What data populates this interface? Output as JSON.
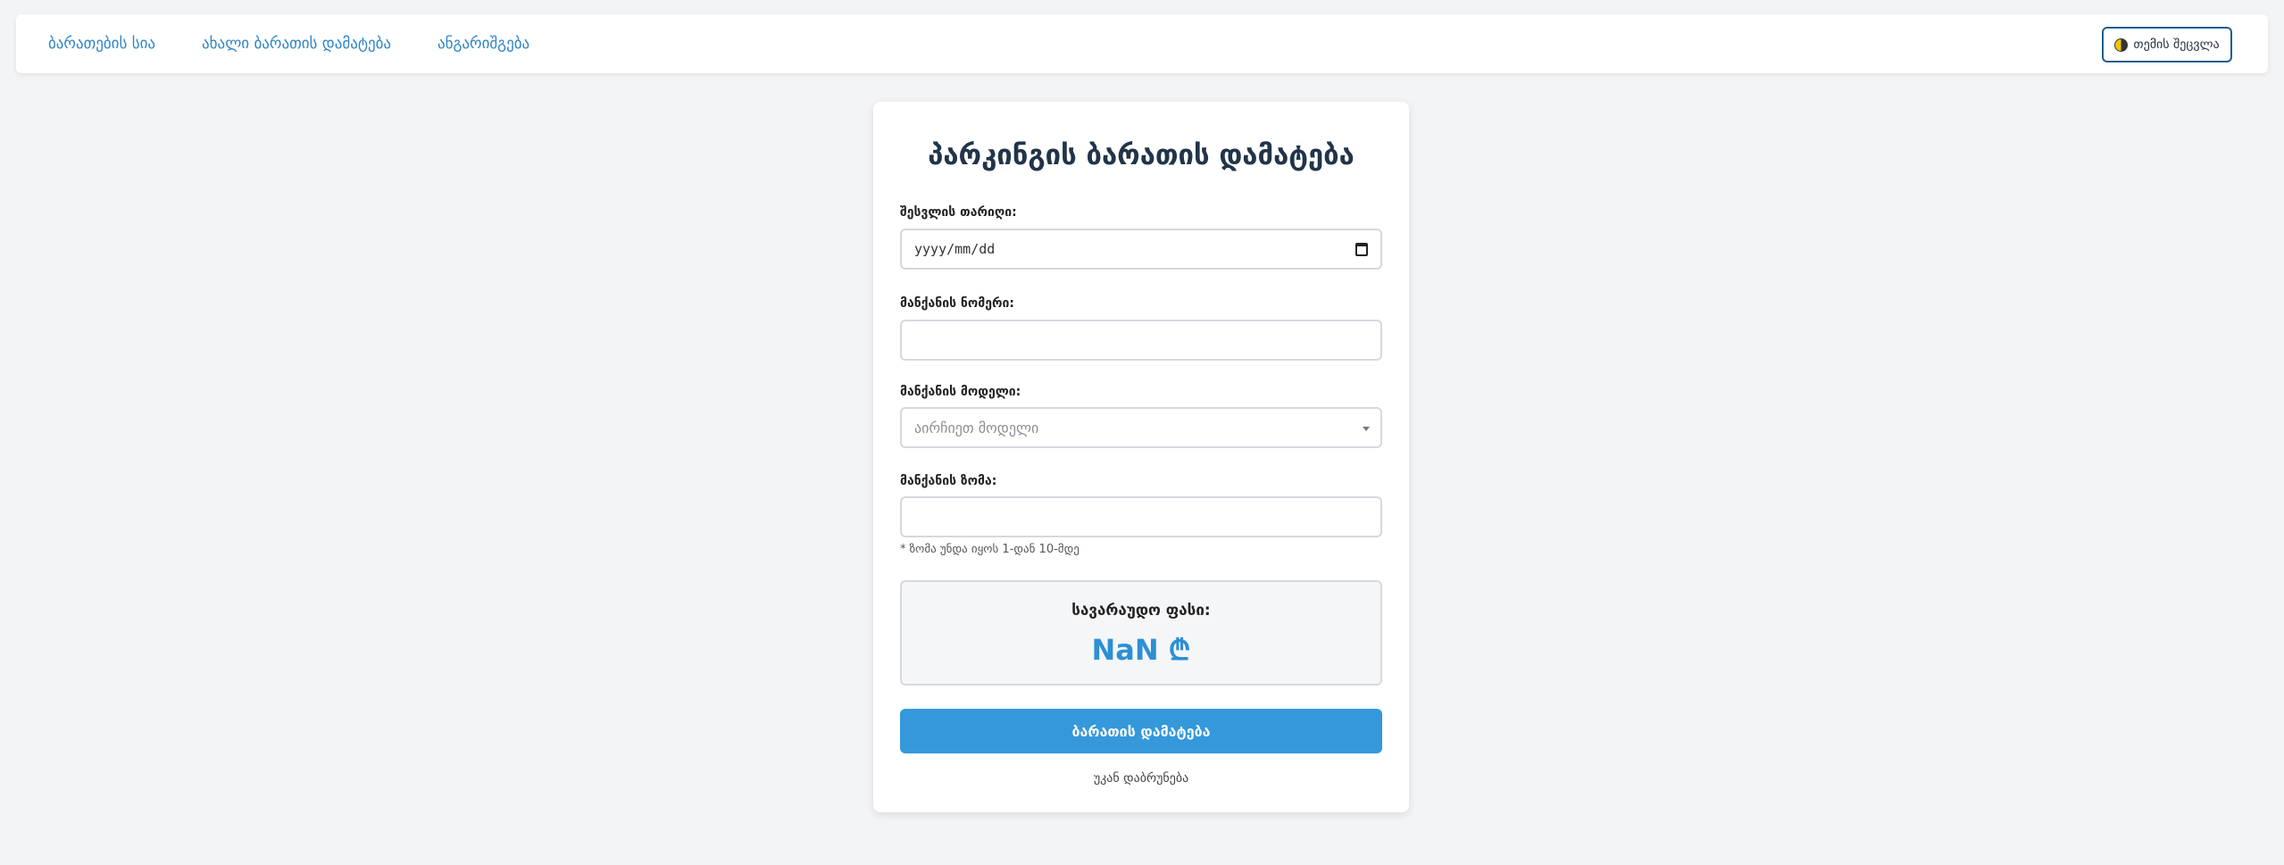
{
  "nav": {
    "links": [
      "ბარათების სია",
      "ახალი ბარათის დამატება",
      "ანგარიშგება"
    ],
    "theme_button": "თემის შეცვლა"
  },
  "form": {
    "title": "პარკინგის ბარათის დამატება",
    "date_label": "შესვლის თარიღი:",
    "date_placeholder": "yyyy/mm/dd",
    "plate_label": "მანქანის ნომერი:",
    "plate_value": "",
    "model_label": "მანქანის მოდელი:",
    "model_placeholder": "აირჩიეთ მოდელი",
    "size_label": "მანქანის ზომა:",
    "size_value": "",
    "size_hint": "* ზომა უნდა იყოს 1-დან 10-მდე",
    "price_label": "სავარაუდო ფასი:",
    "price_value": "NaN ₾",
    "submit_label": "ბარათის დამატება",
    "back_label": "უკან დაბრუნება"
  },
  "colors": {
    "accent": "#3498db",
    "nav_link": "#2d84c9",
    "price": "#2d8fd5"
  }
}
